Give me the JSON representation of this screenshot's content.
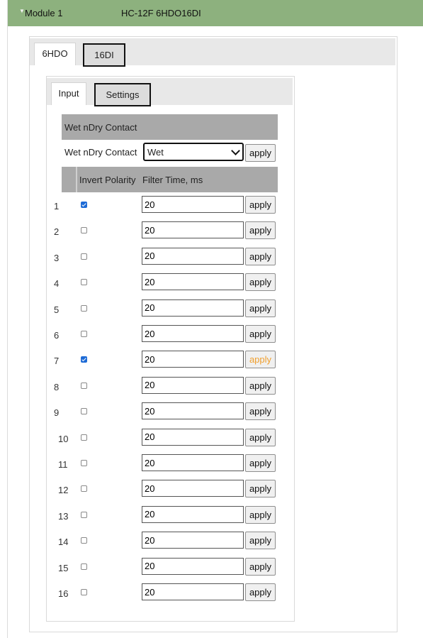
{
  "module": {
    "name": "Module 1",
    "type": "HC-12F 6HDO16DI"
  },
  "outer_tabs": [
    {
      "label": "6HDO",
      "active": false
    },
    {
      "label": "16DI",
      "active": true
    }
  ],
  "inner_tabs": [
    {
      "label": "Input",
      "active": false
    },
    {
      "label": "Settings",
      "active": true
    }
  ],
  "wet_dry": {
    "section_title": "Wet nDry Contact",
    "field_label": "Wet nDry Contact",
    "selected": "Wet",
    "apply_label": "apply"
  },
  "table": {
    "headers": [
      "",
      "Invert Polarity",
      "Filter Time, ms"
    ],
    "rows": [
      {
        "num": "1",
        "invert": true,
        "filter": "20",
        "apply": "apply",
        "pending": false
      },
      {
        "num": "2",
        "invert": false,
        "filter": "20",
        "apply": "apply",
        "pending": false
      },
      {
        "num": "3",
        "invert": false,
        "filter": "20",
        "apply": "apply",
        "pending": false
      },
      {
        "num": "4",
        "invert": false,
        "filter": "20",
        "apply": "apply",
        "pending": false
      },
      {
        "num": "5",
        "invert": false,
        "filter": "20",
        "apply": "apply",
        "pending": false
      },
      {
        "num": "6",
        "invert": false,
        "filter": "20",
        "apply": "apply",
        "pending": false
      },
      {
        "num": "7",
        "invert": true,
        "filter": "20",
        "apply": "apply",
        "pending": true
      },
      {
        "num": "8",
        "invert": false,
        "filter": "20",
        "apply": "apply",
        "pending": false
      },
      {
        "num": "9",
        "invert": false,
        "filter": "20",
        "apply": "apply",
        "pending": false
      },
      {
        "num": "10",
        "invert": false,
        "filter": "20",
        "apply": "apply",
        "pending": false
      },
      {
        "num": "11",
        "invert": false,
        "filter": "20",
        "apply": "apply",
        "pending": false
      },
      {
        "num": "12",
        "invert": false,
        "filter": "20",
        "apply": "apply",
        "pending": false
      },
      {
        "num": "13",
        "invert": false,
        "filter": "20",
        "apply": "apply",
        "pending": false
      },
      {
        "num": "14",
        "invert": false,
        "filter": "20",
        "apply": "apply",
        "pending": false
      },
      {
        "num": "15",
        "invert": false,
        "filter": "20",
        "apply": "apply",
        "pending": false
      },
      {
        "num": "16",
        "invert": false,
        "filter": "20",
        "apply": "apply",
        "pending": false
      }
    ]
  },
  "colors": {
    "header_green": "#8db17e",
    "section_gray": "#a9a9a9",
    "checkbox_blue": "#1e6bd6",
    "pending_apply": "#f0a030"
  },
  "icons": {
    "module_toggle": "chevron-down-icon",
    "select_arrow": "chevron-down-icon"
  }
}
